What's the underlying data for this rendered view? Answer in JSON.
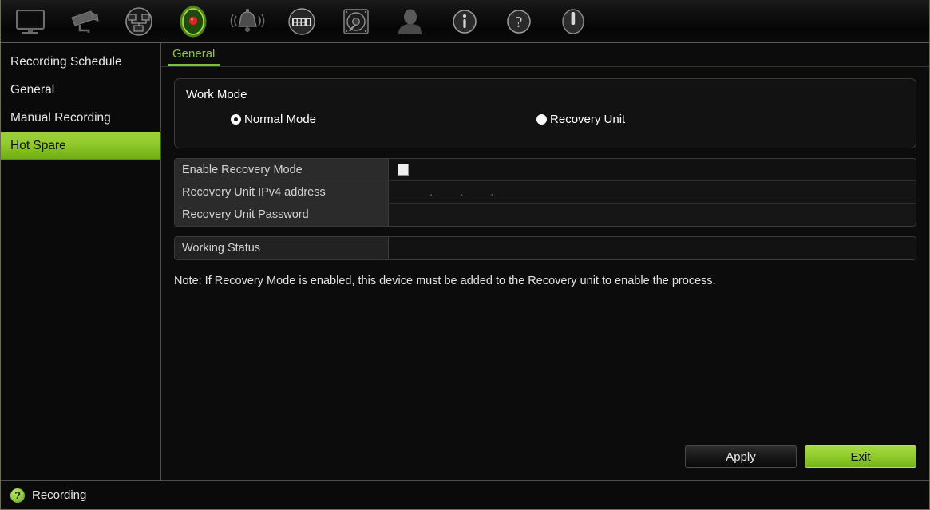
{
  "toolbar": {
    "items": [
      {
        "icon": "monitor-icon",
        "name": "live-view",
        "active": false
      },
      {
        "icon": "camera-icon",
        "name": "playback",
        "active": false
      },
      {
        "icon": "network-globe-icon",
        "name": "network",
        "active": false
      },
      {
        "icon": "record-icon",
        "name": "recording",
        "active": true
      },
      {
        "icon": "alarm-bell-icon",
        "name": "alarm",
        "active": false
      },
      {
        "icon": "device-panel-icon",
        "name": "device-settings",
        "active": false
      },
      {
        "icon": "hard-disk-icon",
        "name": "hdd",
        "active": false
      },
      {
        "icon": "user-icon",
        "name": "user",
        "active": false
      },
      {
        "icon": "info-icon",
        "name": "system-info",
        "active": false
      },
      {
        "icon": "help-question-icon",
        "name": "help",
        "active": false
      },
      {
        "icon": "power-icon",
        "name": "shutdown",
        "active": false
      }
    ]
  },
  "sidebar": {
    "items": [
      {
        "label": "Recording Schedule",
        "active": false
      },
      {
        "label": "General",
        "active": false
      },
      {
        "label": "Manual Recording",
        "active": false
      },
      {
        "label": "Hot Spare",
        "active": true
      }
    ]
  },
  "tabs": [
    {
      "label": "General",
      "active": true
    }
  ],
  "work_mode": {
    "title": "Work Mode",
    "options": [
      {
        "label": "Normal Mode",
        "selected": true
      },
      {
        "label": "Recovery Unit",
        "selected": false
      }
    ]
  },
  "settings": {
    "rows": [
      {
        "label": "Enable Recovery Mode",
        "type": "checkbox",
        "checked": false,
        "value": ""
      },
      {
        "label": "Recovery Unit IPv4 address",
        "type": "ip",
        "value": "",
        "separator": "."
      },
      {
        "label": "Recovery Unit Password",
        "type": "password",
        "value": ""
      }
    ]
  },
  "working_status": {
    "label": "Working Status",
    "value": ""
  },
  "note": "Note: If Recovery Mode is enabled, this device must be added to the Recovery unit to enable the process.",
  "buttons": {
    "apply": "Apply",
    "exit": "Exit"
  },
  "statusbar": {
    "help_glyph": "?",
    "text": "Recording"
  },
  "colors": {
    "accent_green": "#8cc63f",
    "active_green": "#93cd2e",
    "background": "#0a0a0a",
    "panel": "#121212"
  }
}
